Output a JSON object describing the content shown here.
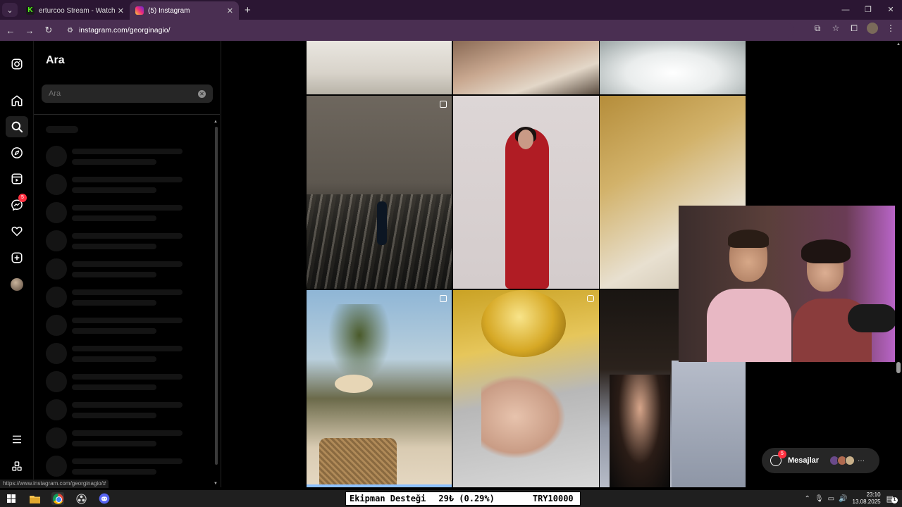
{
  "browser": {
    "tabs": [
      {
        "title": "erturcoo Stream - Watch Live o",
        "favicon": "kick-icon",
        "favicon_letter": "K",
        "active": false
      },
      {
        "title": "(5) Instagram",
        "favicon": "instagram-icon",
        "active": true
      }
    ],
    "url": "instagram.com/georginagio/",
    "status_url": "https://www.instagram.com/georginagio/#"
  },
  "nav": {
    "items": [
      "instagram-logo-icon",
      "home-icon",
      "search-icon",
      "explore-icon",
      "reels-icon",
      "messenger-icon",
      "heart-icon",
      "create-icon",
      "profile-avatar"
    ],
    "messages_badge": "5",
    "bottom": [
      "menu-icon",
      "threads-icon"
    ]
  },
  "search": {
    "title": "Ara",
    "placeholder": "Ara",
    "value": "",
    "skeleton_rows": 12
  },
  "messages": {
    "label": "Mesajlar",
    "badge": "5"
  },
  "ticker": {
    "label": "Ekipman Desteği",
    "amount": "29₺ (0.29%)",
    "goal": "TRY10000"
  },
  "taskbar": {
    "time": "23:10",
    "date": "13.08.2025",
    "apps": [
      "windows-start-icon",
      "file-explorer-icon",
      "chrome-icon",
      "obs-icon",
      "discord-icon"
    ]
  },
  "colors": {
    "accent_badge": "#ff3040",
    "chrome_frame": "#4a2f52",
    "instagram_bg": "#000000"
  }
}
